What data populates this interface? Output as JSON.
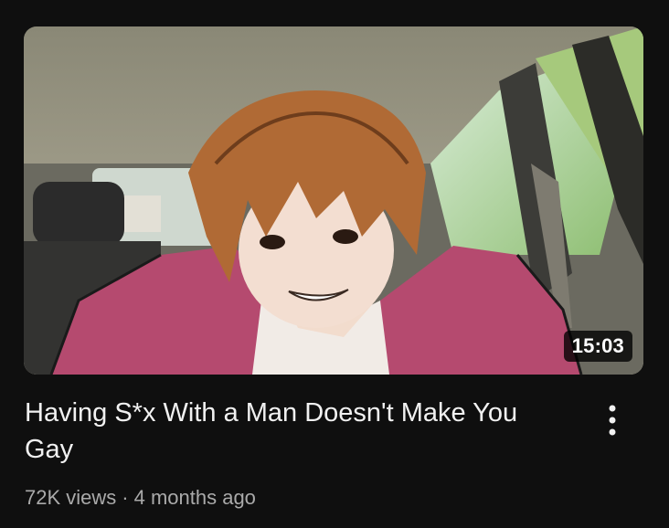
{
  "video": {
    "duration": "15:03",
    "title": "Having S*x With a Man Doesn't Make You Gay",
    "views": "72K views",
    "separator": "·",
    "age": "4 months ago",
    "menu_icon": "more-vert-icon"
  },
  "colors": {
    "background": "#0f0f0f",
    "title_text": "#f1f1f1",
    "meta_text": "#aaaaaa",
    "duration_badge": "#000000"
  }
}
